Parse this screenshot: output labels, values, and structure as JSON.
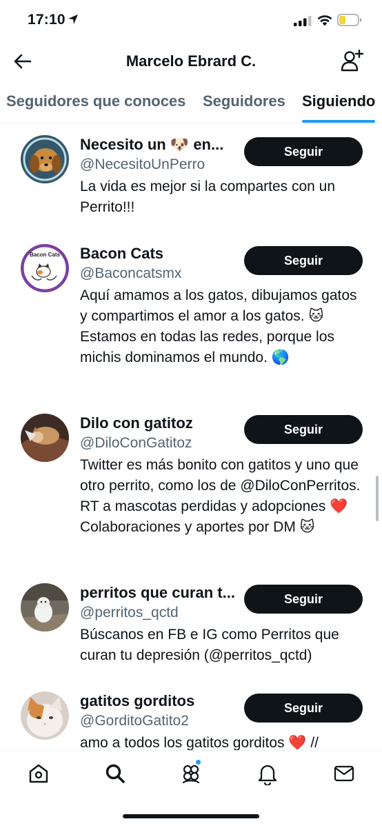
{
  "status_bar": {
    "time": "17:10"
  },
  "header": {
    "title": "Marcelo Ebrard C."
  },
  "tabs": [
    {
      "label": "Seguidores que conoces"
    },
    {
      "label": "Seguidores"
    },
    {
      "label": "Siguiendo"
    }
  ],
  "users": [
    {
      "name": "Necesito un 🐶 en...",
      "handle": "@NecesitoUnPerro",
      "bio": "La vida es mejor si la compartes con un Perrito!!!",
      "button": "Seguir"
    },
    {
      "name": "Bacon Cats",
      "handle": "@Baconcatsmx",
      "bio": "Aquí amamos a los gatos, dibujamos gatos y compartimos el amor a los gatos. 🐱 Estamos en todas las redes, porque los michis dominamos el mundo. 🌎",
      "button": "Seguir",
      "avatar_text": "Bacon Cats"
    },
    {
      "name": "Dilo con gatitoz",
      "handle": "@DiloConGatitoz",
      "bio": "Twitter es más bonito con gatitos y uno que otro perrito, como los de @DiloConPerritos. RT a mascotas perdidas y adopciones ❤️ Colaboraciones y aportes por DM 🐱",
      "button": "Seguir"
    },
    {
      "name": "perritos que curan t...",
      "handle": "@perritos_qctd",
      "bio": "Búscanos en FB e IG como Perritos que curan tu depresión (@perritos_qctd)",
      "button": "Seguir"
    },
    {
      "name": "gatitos gorditos",
      "handle": "@GorditoGatito2",
      "bio": "amo a todos los gatitos gorditos ❤️ //",
      "button": "Seguir"
    }
  ],
  "bottom_nav": [
    {
      "icon": "home-icon"
    },
    {
      "icon": "search-icon"
    },
    {
      "icon": "communities-icon"
    },
    {
      "icon": "notifications-icon"
    },
    {
      "icon": "messages-icon"
    }
  ],
  "colors": {
    "accent": "#1d9bf0",
    "button_bg": "#0f1419",
    "secondary_text": "#536471",
    "battery": "#f5d33c"
  }
}
